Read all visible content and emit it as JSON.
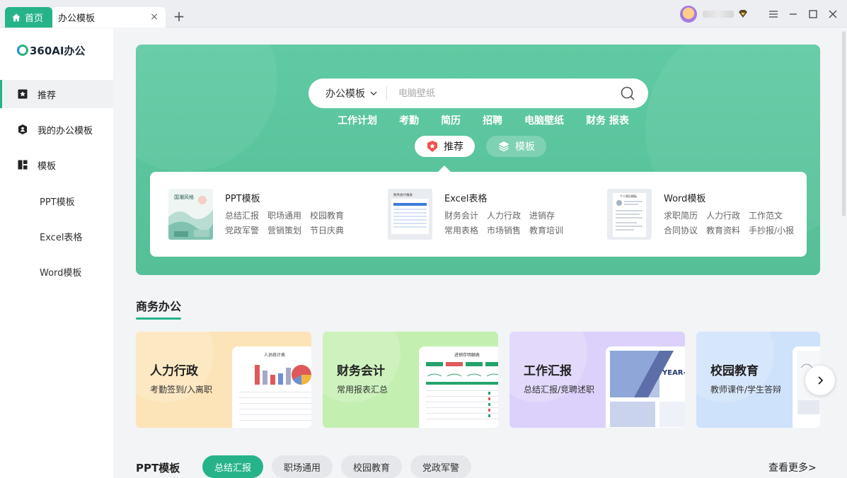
{
  "titlebar": {
    "home_tab": "首页",
    "active_tab": "办公模板",
    "close": "×",
    "add": "+"
  },
  "sidebar": {
    "logo": "360AI办公",
    "items": [
      {
        "label": "推荐",
        "icon": "star-bookmark-icon",
        "active": true
      },
      {
        "label": "我的办公模板",
        "icon": "user-shield-icon",
        "active": false
      },
      {
        "label": "模板",
        "icon": "grid-layout-icon",
        "active": false
      }
    ],
    "sub_items": [
      "PPT模板",
      "Excel表格",
      "Word模板"
    ]
  },
  "search": {
    "category": "办公模板",
    "placeholder": "电脑壁纸"
  },
  "hot_words": [
    "工作计划",
    "考勤",
    "简历",
    "招聘",
    "电脑壁纸",
    "财务 报表"
  ],
  "hero_tabs": [
    {
      "label": "推荐",
      "active": true
    },
    {
      "label": "模板",
      "active": false
    }
  ],
  "categories": [
    {
      "title": "PPT模板",
      "links": [
        "总结汇报",
        "职场通用",
        "校园教育",
        "党政军警",
        "营销策划",
        "节日庆典"
      ]
    },
    {
      "title": "Excel表格",
      "links": [
        "财务会计",
        "人力行政",
        "进销存",
        "常用表格",
        "市场销售",
        "教育培训"
      ]
    },
    {
      "title": "Word模板",
      "links": [
        "求职简历",
        "人力行政",
        "工作范文",
        "合同协议",
        "教育资料",
        "手抄报/小报"
      ]
    }
  ],
  "thumb_texts": {
    "excel_title": "财务会计报表",
    "word_title": "个人简历模板",
    "ppt_title": "国潮风格"
  },
  "business": {
    "title": "商务办公",
    "cards": [
      {
        "title": "人力行政",
        "subtitle": "考勤签到/入离职",
        "preview_title": "人员统计表"
      },
      {
        "title": "财务会计",
        "subtitle": "常用报表汇总",
        "preview_title": "进销存明细表"
      },
      {
        "title": "工作汇报",
        "subtitle": "总结汇报/竞聘述职",
        "preview_title": "YEAR-"
      },
      {
        "title": "校园教育",
        "subtitle": "教师课件/学生答辩",
        "preview_title": ""
      }
    ]
  },
  "ppt_section": {
    "title": "PPT模板",
    "pills": [
      {
        "label": "总结汇报",
        "active": true
      },
      {
        "label": "职场通用",
        "active": false
      },
      {
        "label": "校园教育",
        "active": false
      },
      {
        "label": "党政军警",
        "active": false
      }
    ],
    "more": "查看更多>"
  },
  "colors": {
    "accent": "#26b38a",
    "hero": "#5ac5a0",
    "card_hr": "#fde3b8",
    "card_finance": "#c3efb0",
    "card_report": "#dcd1fb",
    "card_school": "#cfe2fb"
  }
}
